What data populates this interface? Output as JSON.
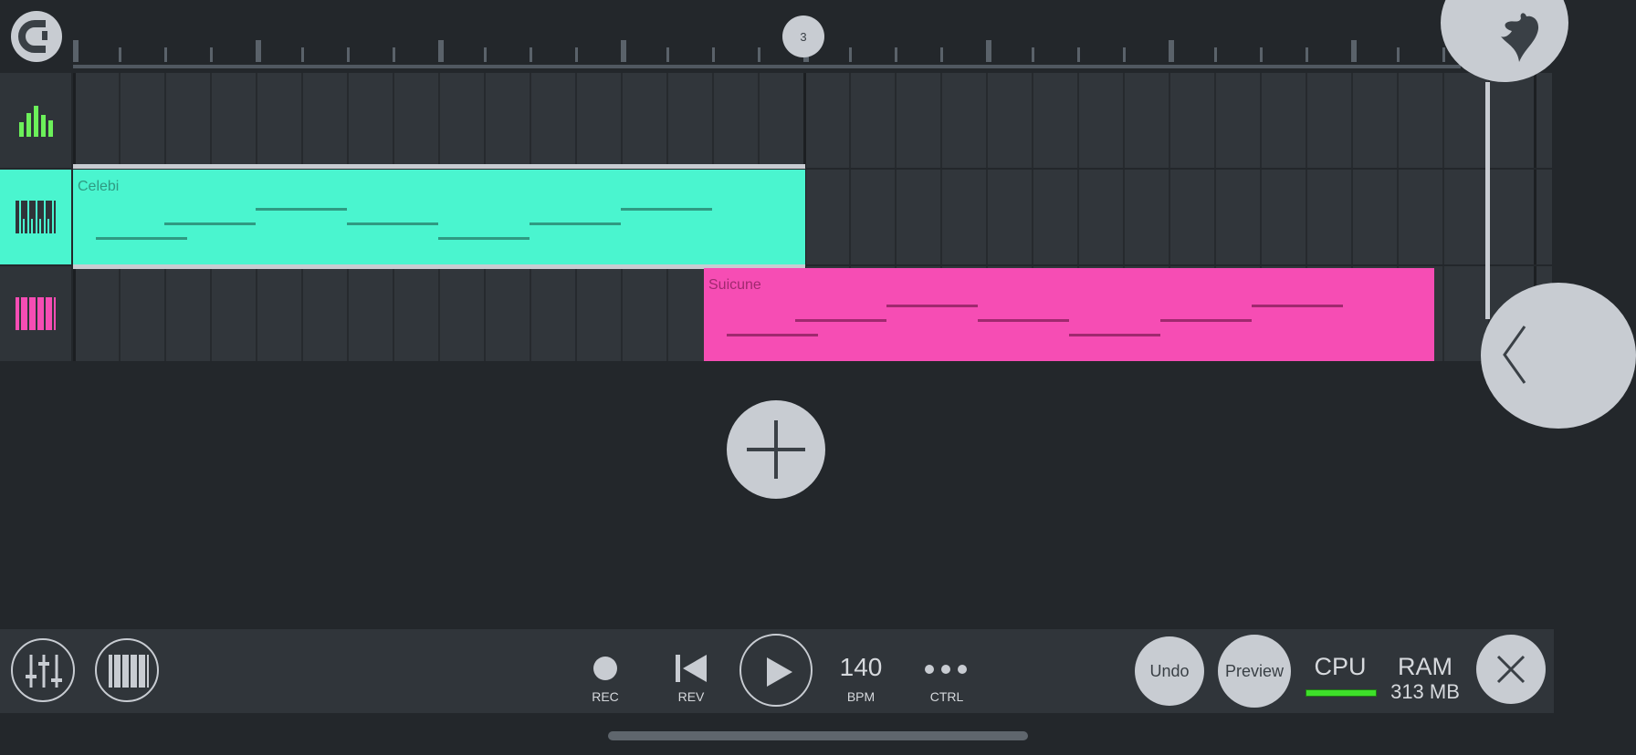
{
  "ruler": {
    "playhead_label": "3"
  },
  "tracks": [
    {
      "icon": "mixer-bars-icon",
      "color": "#6cf05a"
    },
    {
      "icon": "piano-keys-icon",
      "color": "#2f3439"
    },
    {
      "icon": "piano-keys-icon",
      "color": "#f64db4"
    }
  ],
  "clips": [
    {
      "name": "Celebi",
      "color": "#4af5cf",
      "text_color": "#2f9a82"
    },
    {
      "name": "Suicune",
      "color": "#f64db4",
      "text_color": "#a0296f"
    }
  ],
  "toolbar": {
    "rec_label": "REC",
    "rev_label": "REV",
    "bpm_value": "140",
    "bpm_label": "BPM",
    "ctrl_label": "CTRL",
    "undo_label": "Undo",
    "preview_label": "Preview",
    "cpu_label": "CPU",
    "ram_label": "RAM",
    "ram_value": "313 MB"
  },
  "colors": {
    "accent": "#c8ccd2",
    "cpu_meter": "#3ee02a"
  }
}
